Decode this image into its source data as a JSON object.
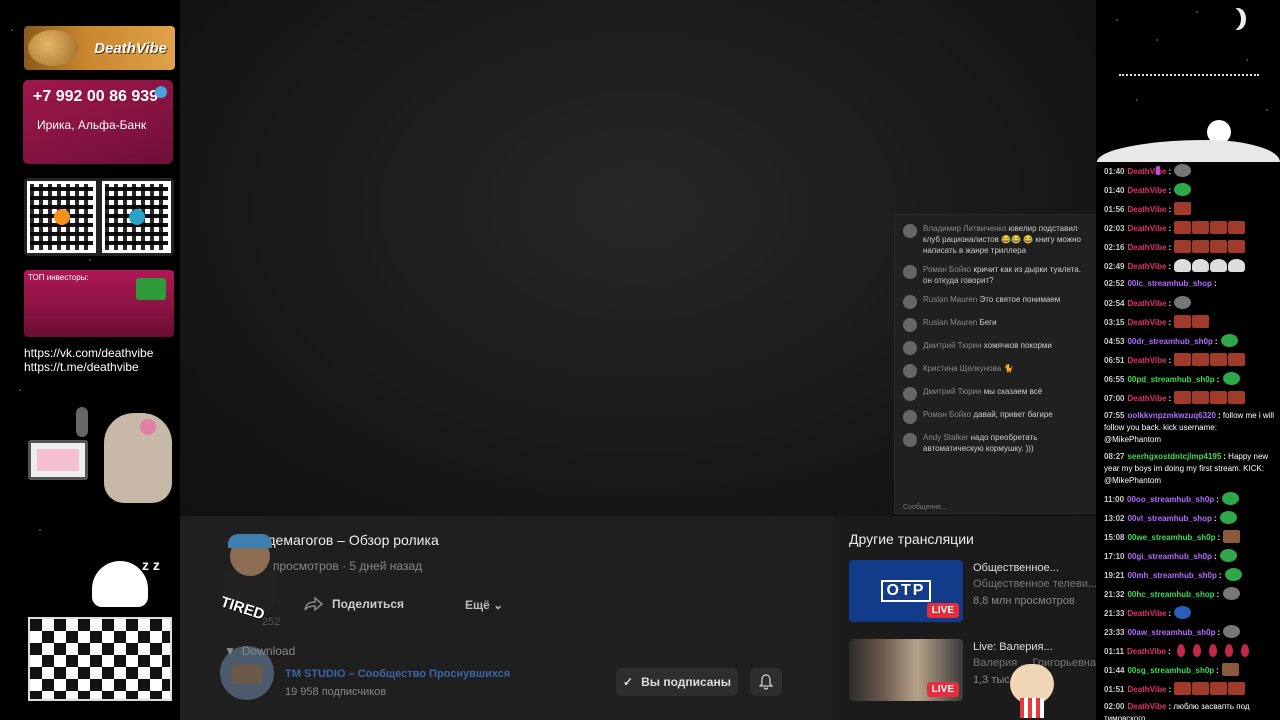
{
  "left_overlay": {
    "banner_title": "DeathVibe",
    "phone": "+7 992 00 86 939",
    "bank": "Ирика, Альфа-Банк",
    "investors_label": "ТОП инвесторы:",
    "links": [
      "https://vk.com/deathvibe",
      "https://t.me/deathvibe"
    ]
  },
  "overlay_chat": {
    "messages": [
      {
        "name": "Владимир Литвиченко",
        "text": "ювелир подставил клуб рационалистов 😂😂 😂 книгу можно написать в жанре триллера"
      },
      {
        "name": "Роман Бойко",
        "text": "кричит как из дырки туалета. он откуда говорит?"
      },
      {
        "name": "Ruslan Mauren",
        "text": "Это святое понимаем"
      },
      {
        "name": "Ruslan Mauren",
        "text": "Беги"
      },
      {
        "name": "Дмитрий Тюрин",
        "text": "хомячков покорми"
      },
      {
        "name": "Кристина Щелкунова",
        "text": "🐈"
      },
      {
        "name": "Дмитрий Тюрин",
        "text": "мы сказаем всё"
      },
      {
        "name": "Роман Бойко",
        "text": "давай, привет багире"
      },
      {
        "name": "Andy Stalker",
        "text": "надо преобретать автоматическую кормушку. )))"
      }
    ],
    "bottom": "Сообщение..."
  },
  "video": {
    "title": "Клуб демагогов – Обзор ролика",
    "meta_views": "просмотров",
    "meta_age": "5 дней назад",
    "share_label": "Поделиться",
    "more_label": "Ещё",
    "download_label": "Download",
    "tired_word": "TIRED",
    "tired_num": "252"
  },
  "channel": {
    "name": "TM STUDIO – Сообщество Проснувшихся",
    "subscribers": "19 958 подписчиков",
    "subscribed_label": "Вы подписаны"
  },
  "sidebar": {
    "title": "Другие трансляции",
    "items": [
      {
        "title": "Общественное...",
        "subtitle": "Общественное телеви...",
        "views": "8,8 млн просмотров",
        "live": "LIVE",
        "logo": "OTP"
      },
      {
        "title": "Live: Валерия...",
        "subtitle": "Валерия ... Григорьевна ...",
        "views": "1,3 тыс. ...",
        "live": "LIVE"
      }
    ]
  },
  "chat": {
    "messages": [
      {
        "time": "01:40",
        "user": "DeathVibe",
        "color": "#e2336b",
        "mic": true,
        "msg": "",
        "emotes": [
          "gray"
        ]
      },
      {
        "time": "01:40",
        "user": "DeathVibe",
        "color": "#e2336b",
        "mic": true,
        "msg": "",
        "emotes": [
          "green"
        ]
      },
      {
        "time": "01:56",
        "user": "DeathVibe",
        "color": "#e2336b",
        "mic": true,
        "msg": "",
        "emotes": [
          "red"
        ]
      },
      {
        "time": "02:03",
        "user": "DeathVibe",
        "color": "#e2336b",
        "mic": true,
        "msg": "",
        "emotes": [
          "red",
          "red",
          "red",
          "red"
        ]
      },
      {
        "time": "02:16",
        "user": "DeathVibe",
        "color": "#e2336b",
        "mic": true,
        "msg": "",
        "emotes": [
          "red",
          "red",
          "red",
          "red"
        ]
      },
      {
        "time": "02:49",
        "user": "DeathVibe",
        "color": "#e2336b",
        "mic": true,
        "msg": "",
        "emotes": [
          "white",
          "white",
          "white",
          "white"
        ]
      },
      {
        "time": "02:52",
        "user": "00lc_streamhub_shop",
        "color": "#b36bff",
        "mic": false,
        "msg": "",
        "emotes": []
      },
      {
        "time": "02:54",
        "user": "DeathVibe",
        "color": "#e2336b",
        "mic": true,
        "msg": "",
        "emotes": [
          "gray"
        ]
      },
      {
        "time": "03:15",
        "user": "DeathVibe",
        "color": "#e2336b",
        "mic": true,
        "msg": "",
        "emotes": [
          "red",
          "red"
        ]
      },
      {
        "time": "04:53",
        "user": "00dr_streamhub_sh0p",
        "color": "#b36bff",
        "mic": false,
        "msg": "",
        "emotes": [
          "green"
        ]
      },
      {
        "time": "06:51",
        "user": "DeathVibe",
        "color": "#e2336b",
        "mic": true,
        "msg": "",
        "emotes": [
          "red",
          "red",
          "red",
          "red"
        ]
      },
      {
        "time": "06:55",
        "user": "00pd_streamhub_sh0p",
        "color": "#3fdc5a",
        "mic": false,
        "msg": "",
        "emotes": [
          "green"
        ]
      },
      {
        "time": "07:00",
        "user": "DeathVibe",
        "color": "#e2336b",
        "mic": true,
        "msg": "",
        "emotes": [
          "red",
          "red",
          "red",
          "red"
        ]
      },
      {
        "time": "07:55",
        "user": "oolkkvnpzmkwzuq6320",
        "color": "#b36bff",
        "mic": false,
        "msg": "follow me i will follow you back. kick username: @MikePhantom",
        "emotes": []
      },
      {
        "time": "08:27",
        "user": "seerhgxostdntcjlmp4195",
        "color": "#3fdc5a",
        "mic": false,
        "msg": "Happy new year my boys im doing my first stream. KICK: @MikePhantom",
        "emotes": []
      },
      {
        "time": "11:00",
        "user": "00oo_streamhub_sh0p",
        "color": "#b36bff",
        "mic": false,
        "msg": "",
        "emotes": [
          "green"
        ]
      },
      {
        "time": "13:02",
        "user": "00vl_streamhub_shop",
        "color": "#b36bff",
        "mic": false,
        "msg": "",
        "emotes": [
          "green"
        ]
      },
      {
        "time": "15:08",
        "user": "00we_streamhub_sh0p",
        "color": "#3fdc5a",
        "mic": false,
        "msg": "",
        "emotes": [
          "brown"
        ]
      },
      {
        "time": "17:10",
        "user": "00gi_streamhub_sh0p",
        "color": "#b36bff",
        "mic": false,
        "msg": "",
        "emotes": [
          "green"
        ]
      },
      {
        "time": "19:21",
        "user": "00mh_streamhub_sh0p",
        "color": "#b36bff",
        "mic": false,
        "msg": "",
        "emotes": [
          "green"
        ]
      },
      {
        "time": "21:32",
        "user": "00hc_streamhub_shop",
        "color": "#3fdc5a",
        "mic": false,
        "msg": "",
        "emotes": [
          "gray"
        ]
      },
      {
        "time": "21:33",
        "user": "DeathVibe",
        "color": "#e2336b",
        "mic": true,
        "msg": "",
        "emotes": [
          "blue"
        ]
      },
      {
        "time": "23:33",
        "user": "00aw_streamhub_sh0p",
        "color": "#b36bff",
        "mic": false,
        "msg": "",
        "emotes": [
          "gray"
        ]
      },
      {
        "time": "01:11",
        "user": "DeathVibe",
        "color": "#e2336b",
        "mic": true,
        "msg": "",
        "emotes": [
          "drop",
          "drop",
          "drop",
          "drop",
          "drop"
        ]
      },
      {
        "time": "01:44",
        "user": "00sg_streamhub_sh0p",
        "color": "#3fdc5a",
        "mic": false,
        "msg": "",
        "emotes": [
          "brown"
        ]
      },
      {
        "time": "01:51",
        "user": "DeathVibe",
        "color": "#e2336b",
        "mic": true,
        "msg": "",
        "emotes": [
          "red",
          "red",
          "red",
          "red"
        ]
      },
      {
        "time": "02:00",
        "user": "DeathVibe",
        "color": "#e2336b",
        "mic": true,
        "msg": "люблю засвапть под тимовского",
        "emotes": []
      }
    ]
  }
}
